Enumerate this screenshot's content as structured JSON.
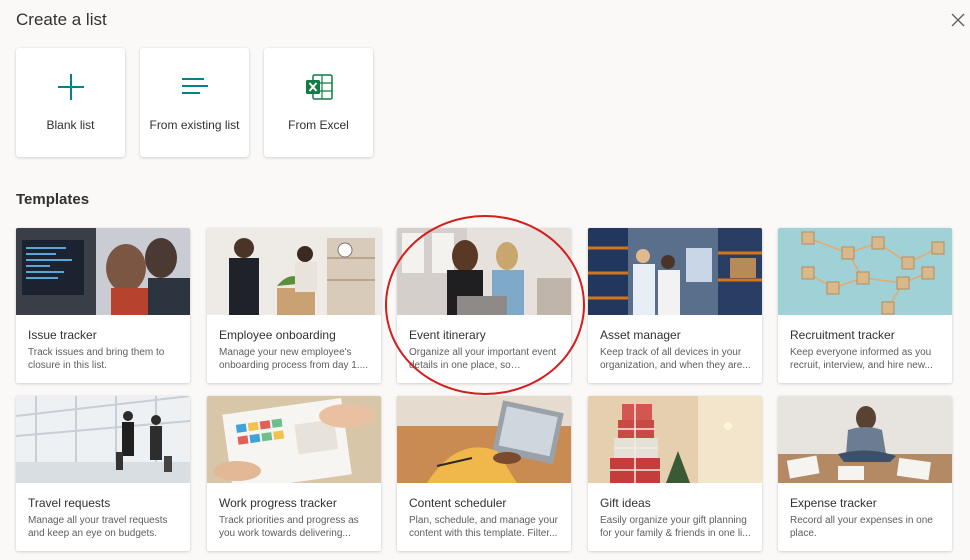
{
  "header": {
    "title": "Create a list"
  },
  "create_options": [
    {
      "label": "Blank list",
      "icon": "plus-icon"
    },
    {
      "label": "From existing list",
      "icon": "list-lines-icon"
    },
    {
      "label": "From Excel",
      "icon": "excel-icon"
    }
  ],
  "templates": {
    "title": "Templates",
    "items": [
      {
        "name": "Issue tracker",
        "description": "Track issues and bring them to closure in this list."
      },
      {
        "name": "Employee onboarding",
        "description": "Manage your new employee's onboarding process from day 1...."
      },
      {
        "name": "Event itinerary",
        "description": "Organize all your important event details in one place, so everythin..."
      },
      {
        "name": "Asset manager",
        "description": "Keep track of all devices in your organization, and when they are..."
      },
      {
        "name": "Recruitment tracker",
        "description": "Keep everyone informed as you recruit, interview, and hire new..."
      },
      {
        "name": "Travel requests",
        "description": "Manage all your travel requests and keep an eye on budgets."
      },
      {
        "name": "Work progress tracker",
        "description": "Track priorities and progress as you work towards delivering..."
      },
      {
        "name": "Content scheduler",
        "description": "Plan, schedule, and manage your content with this template. Filter..."
      },
      {
        "name": "Gift ideas",
        "description": "Easily organize your gift planning for your family & friends in one li..."
      },
      {
        "name": "Expense tracker",
        "description": "Record all your expenses in one place."
      }
    ]
  },
  "colors": {
    "accent": "#038387",
    "excel": "#107c41",
    "highlight": "#d41d1d"
  }
}
